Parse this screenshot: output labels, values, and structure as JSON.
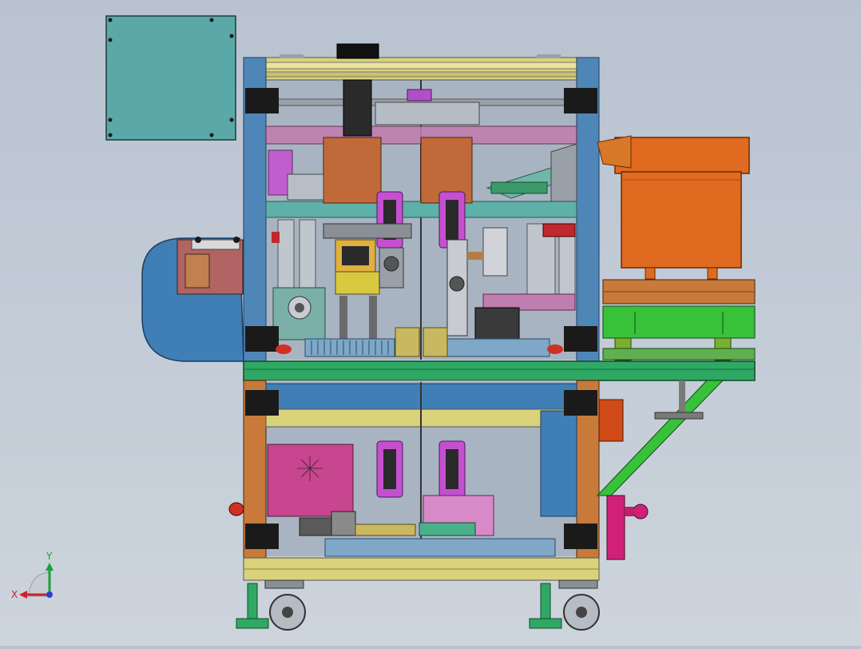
{
  "viewport": {
    "background_top": "#b9c3d0",
    "background_bottom": "#cdd4dc",
    "render_style": "shaded-with-edges"
  },
  "triad": {
    "x_label": "X",
    "y_label": "Y",
    "x_color": "#d0202a",
    "y_color": "#1aa03a",
    "z_color": "#2a3ed0"
  },
  "colors": {
    "frame_blue": "#4f86b8",
    "frame_orange": "#c77a3a",
    "base_green": "#2fa864",
    "top_yellow": "#d9d27a",
    "panel_teal": "#5aa8a8",
    "bowl_orange": "#e06a1f",
    "magenta_part": "#c64fd1",
    "cover_blue": "#3f7fb6",
    "green_support": "#38c23a",
    "gray_metal": "#a3a9b1"
  },
  "components": [
    "electrical-panel",
    "aluminum-frame",
    "vibratory-feeder-bowl",
    "feeder-base",
    "side-guard-cover",
    "control-box",
    "cable-tray",
    "caster-wheels",
    "leveling-feet",
    "air-filter-regulator"
  ]
}
